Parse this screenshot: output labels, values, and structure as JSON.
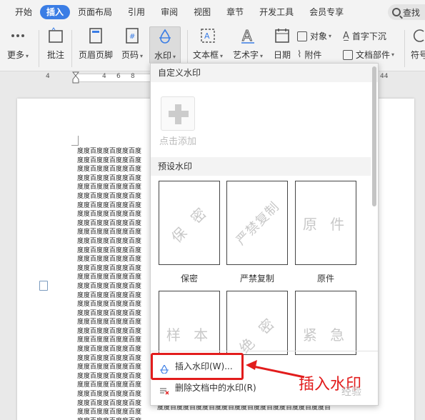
{
  "menubar": {
    "tabs": [
      "开始",
      "插入",
      "页面布局",
      "引用",
      "审阅",
      "视图",
      "章节",
      "开发工具",
      "会员专享"
    ],
    "active_tab": "插入",
    "search_label": "查找"
  },
  "ribbon": {
    "more": "更多",
    "comment": "批注",
    "header_footer": "页眉页脚",
    "page_number": "页码",
    "watermark": "水印",
    "textbox": "文本框",
    "wordart": "艺术字",
    "date": "日期",
    "object": "对象",
    "attachment": "附件",
    "dropcap": "首字下沉",
    "doc_parts": "文档部件",
    "symbol": "符号"
  },
  "ruler": {
    "nums": [
      "4",
      "4",
      "6",
      "8",
      "44"
    ]
  },
  "document": {
    "line_text": "度度百度度百度度百度",
    "bottom_line": "度度百度度百度度百度度百度度百度度百度度百度度百度度百"
  },
  "dropdown": {
    "custom_header": "自定义水印",
    "add_label": "点击添加",
    "preset_header": "预设水印",
    "presets": [
      {
        "text": "保 密",
        "label": "保密",
        "style": "diagonal"
      },
      {
        "text": "严禁复制",
        "label": "严禁复制",
        "style": "diagonal"
      },
      {
        "text": "原 件",
        "label": "原件",
        "style": "horizontal"
      },
      {
        "text": "样 本",
        "label": "",
        "style": "horizontal"
      },
      {
        "text": "绝 密",
        "label": "",
        "style": "diagonal"
      },
      {
        "text": "紧 急",
        "label": "",
        "style": "horizontal"
      }
    ],
    "insert_item": "插入水印(W)...",
    "delete_item": "删除文档中的水印(R)"
  },
  "annotation": {
    "text": "插入水印",
    "color": "#e21c1c"
  },
  "site_watermark": "经验"
}
